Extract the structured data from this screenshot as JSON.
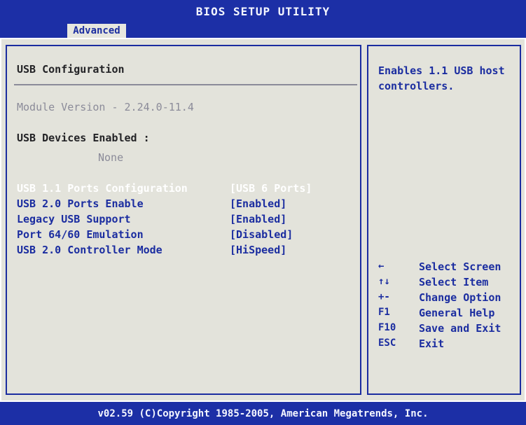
{
  "window": {
    "title": "BIOS SETUP UTILITY",
    "active_tab": "Advanced"
  },
  "main": {
    "section_title": "USB Configuration",
    "module_version": "Module Version - 2.24.0-11.4",
    "usb_devices_label": "USB Devices Enabled :",
    "usb_devices_value": "None",
    "settings": [
      {
        "label": "USB 1.1 Ports Configuration",
        "value": "[USB 6 Ports]",
        "selected": true
      },
      {
        "label": "USB 2.0 Ports Enable",
        "value": "[Enabled]",
        "selected": false
      },
      {
        "label": "Legacy USB Support",
        "value": "[Enabled]",
        "selected": false
      },
      {
        "label": "Port 64/60 Emulation",
        "value": "[Disabled]",
        "selected": false
      },
      {
        "label": "USB 2.0 Controller Mode",
        "value": "[HiSpeed]",
        "selected": false
      }
    ]
  },
  "help": {
    "description": "Enables 1.1 USB host controllers.",
    "keys": [
      {
        "key": "←",
        "action": "Select Screen"
      },
      {
        "key": "↑↓",
        "action": "Select Item"
      },
      {
        "key": "+-",
        "action": "Change Option"
      },
      {
        "key": "F1",
        "action": "General Help"
      },
      {
        "key": "F10",
        "action": "Save and Exit"
      },
      {
        "key": "ESC",
        "action": "Exit"
      }
    ]
  },
  "footer": {
    "copyright": "v02.59 (C)Copyright 1985-2005, American Megatrends, Inc."
  },
  "colors": {
    "background": "#0f1b6e",
    "bar_blue": "#1c2fa6",
    "panel_gray": "#e3e3db",
    "text_blue": "#1b2da0",
    "selected_text": "#ffffff"
  }
}
